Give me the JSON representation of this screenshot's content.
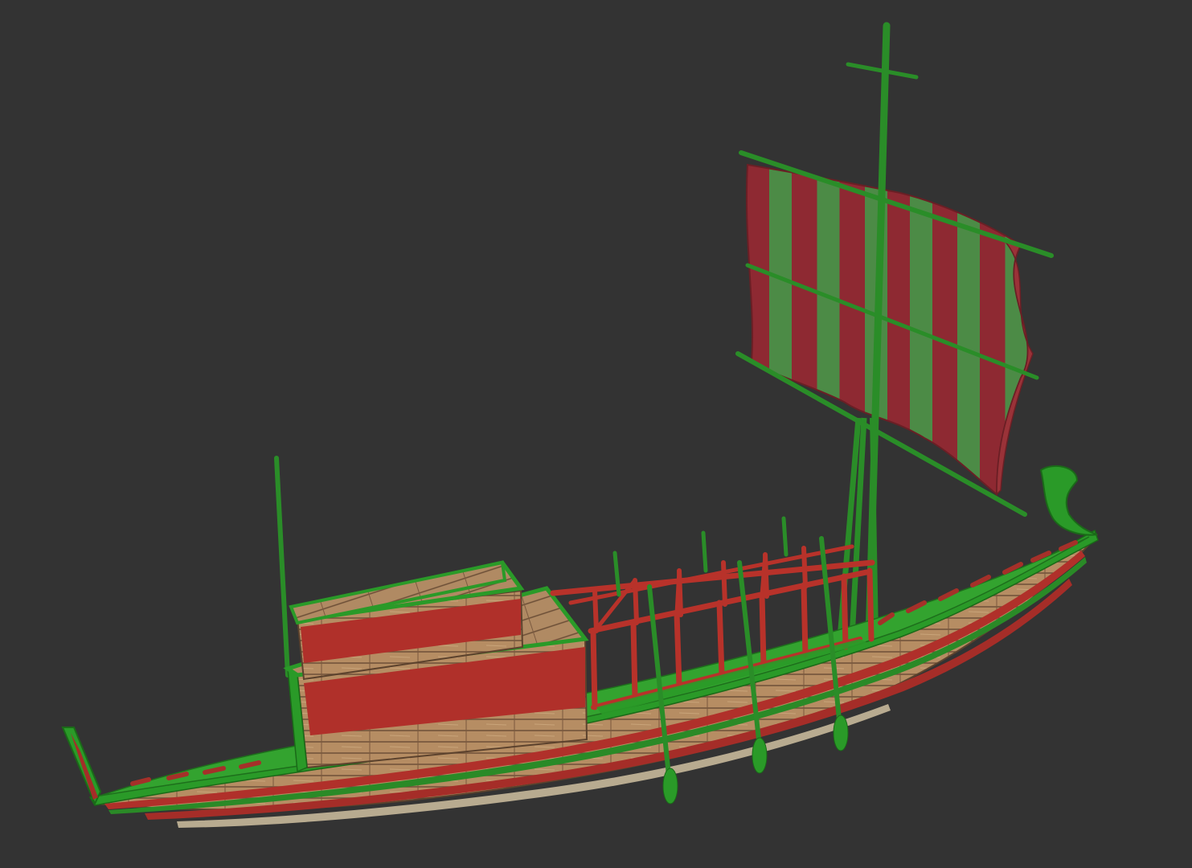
{
  "scene": {
    "background_color": "#333333",
    "subject": "ship-model-render",
    "colors": {
      "wood": "#b88f66",
      "wood_dark": "#8a6748",
      "red": "#b8322a",
      "red_dark": "#8e231d",
      "green": "#2f9b2c",
      "green_dark": "#1d6d1b",
      "sail_red": "#8f2b32",
      "sail_green": "#4d8f47"
    }
  }
}
